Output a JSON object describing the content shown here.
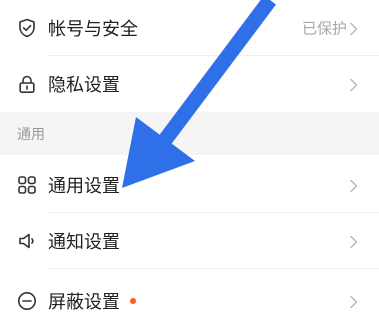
{
  "settings": {
    "rows_top": [
      {
        "label": "帐号与安全",
        "status": "已保护",
        "icon": "shield-check-icon"
      },
      {
        "label": "隐私设置",
        "status": "",
        "icon": "lock-icon"
      }
    ],
    "section_general": {
      "title": "通用"
    },
    "rows_bottom": [
      {
        "label": "通用设置",
        "icon": "grid-icon"
      },
      {
        "label": "通知设置",
        "icon": "speaker-icon"
      },
      {
        "label": "屏蔽设置",
        "icon": "minus-circle-icon",
        "has_dot": true
      }
    ]
  },
  "colors": {
    "accent_dot": "#ff5a1f",
    "annotation_arrow": "#2f6fe8"
  }
}
